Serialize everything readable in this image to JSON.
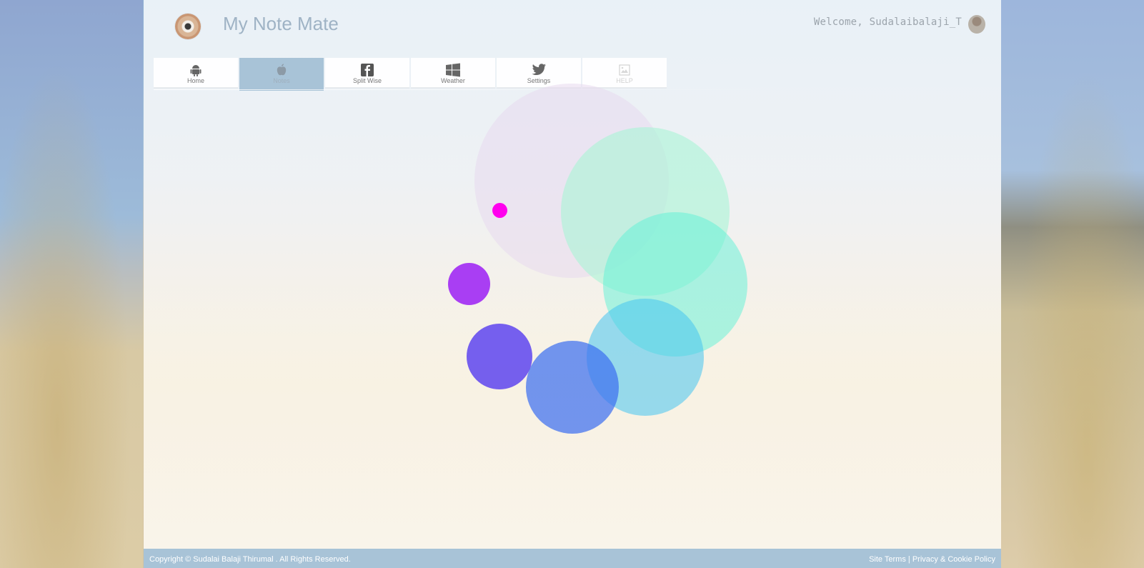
{
  "app": {
    "title": "My Note Mate",
    "welcome": "Welcome, Sudalaibalaji_T"
  },
  "tabs": [
    {
      "label": "Home",
      "icon": "android-icon",
      "active": false
    },
    {
      "label": "Notes",
      "icon": "apple-icon",
      "active": true
    },
    {
      "label": "Split Wise",
      "icon": "facebook-icon",
      "active": false
    },
    {
      "label": "Weather",
      "icon": "windows-icon",
      "active": false
    },
    {
      "label": "Settings",
      "icon": "twitter-icon",
      "active": false
    },
    {
      "label": "HELP",
      "icon": "broken-image-icon",
      "active": false
    }
  ],
  "bubbles": [
    {
      "color": "#e8d8ee",
      "opacity": 0.55
    },
    {
      "color": "#a8f5d6",
      "opacity": 0.6
    },
    {
      "color": "#5ef2d6",
      "opacity": 0.5
    },
    {
      "color": "#45c5f0",
      "opacity": 0.55
    },
    {
      "color": "#3d6ff0",
      "opacity": 0.72
    },
    {
      "color": "#4a2ef0",
      "opacity": 0.75
    },
    {
      "color": "#9b1ff5",
      "opacity": 0.85
    },
    {
      "color": "#ff00ee",
      "opacity": 1.0
    }
  ],
  "footer": {
    "copyright": "Copyright © Sudalai Balaji Thirumal . All Rights Reserved.",
    "site_terms": "Site Terms",
    "separator": " | ",
    "privacy": "Privacy & Cookie Policy"
  }
}
